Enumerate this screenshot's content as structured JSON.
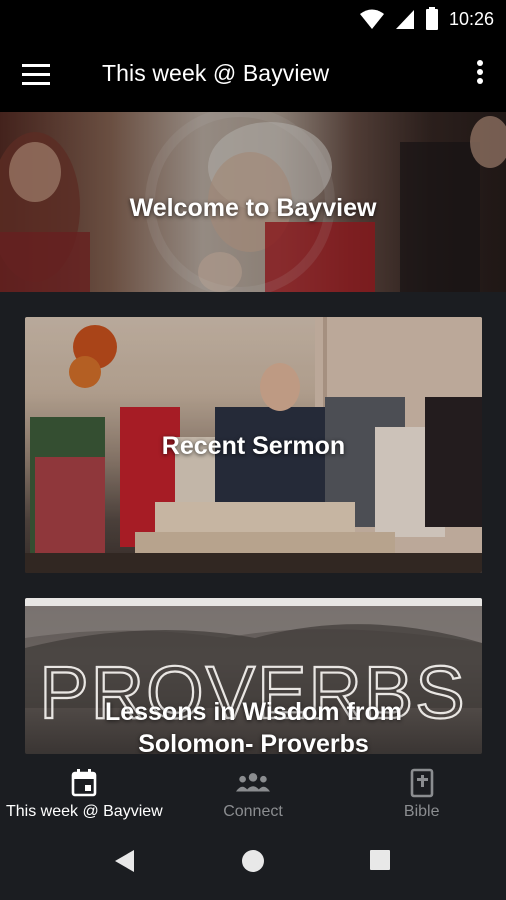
{
  "status_bar": {
    "time": "10:26"
  },
  "app_bar": {
    "title": "This week @ Bayview"
  },
  "tiles": {
    "welcome": {
      "title": "Welcome to Bayview"
    },
    "sermon": {
      "title": "Recent Sermon"
    },
    "proverbs": {
      "title": "Lessons in Wisdom from Solomon- Proverbs",
      "art_text": "PROVERBS"
    }
  },
  "bottom_nav": {
    "items": [
      {
        "label": "This week @ Bayview",
        "icon": "calendar-icon",
        "active": true
      },
      {
        "label": "Connect",
        "icon": "people-icon",
        "active": false
      },
      {
        "label": "Bible",
        "icon": "bible-icon",
        "active": false
      }
    ]
  },
  "colors": {
    "bar_bg": "#000000",
    "page_bg": "#1b1d21",
    "nav_inactive": "#8b8d90",
    "nav_active": "#ffffff"
  }
}
